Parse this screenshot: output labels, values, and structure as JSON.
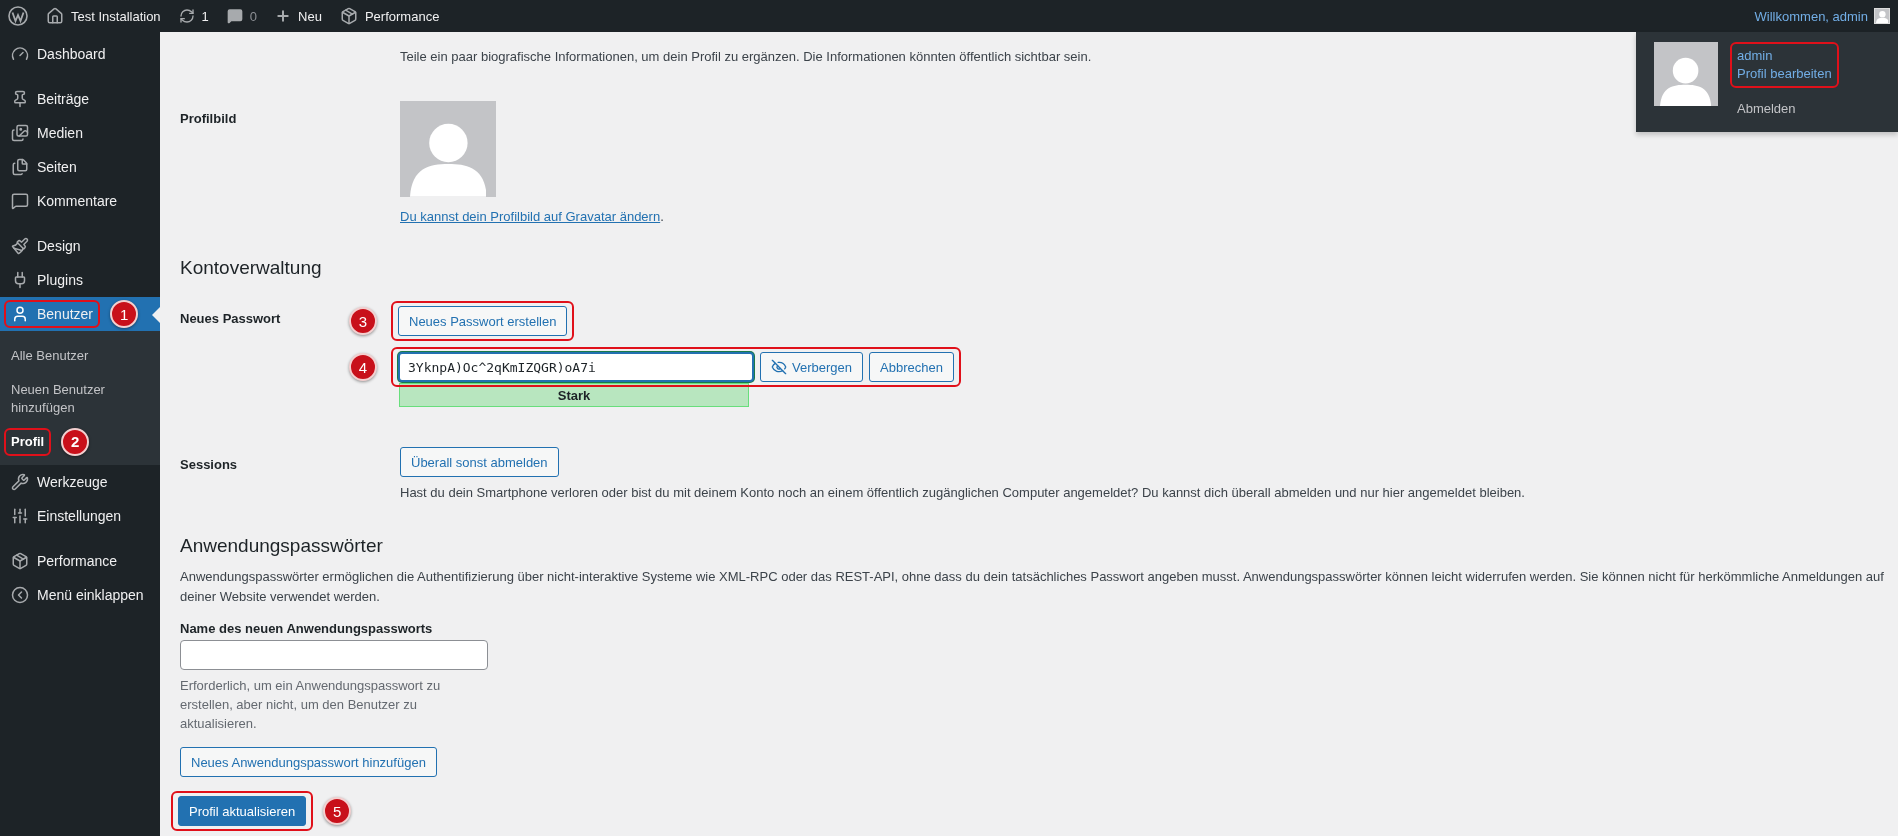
{
  "admin_bar": {
    "items": [
      {
        "kind": "logo"
      },
      {
        "kind": "site",
        "label": "Test Installation"
      },
      {
        "kind": "updates",
        "label": "1"
      },
      {
        "kind": "comments",
        "label": "0"
      },
      {
        "kind": "new",
        "label": "Neu"
      },
      {
        "kind": "performance",
        "label": "Performance"
      }
    ],
    "greeting": "Willkommen, admin"
  },
  "user_menu": {
    "name": "admin",
    "edit_link": "Profil bearbeiten",
    "logout": "Abmelden",
    "highlighted": true
  },
  "sidebar": {
    "groups": [
      [
        {
          "label": "Dashboard",
          "selected": false,
          "highlighted": false
        }
      ],
      [
        {
          "label": "Beiträge",
          "selected": false,
          "highlighted": false
        },
        {
          "label": "Medien",
          "selected": false,
          "highlighted": false
        },
        {
          "label": "Seiten",
          "selected": false,
          "highlighted": false
        },
        {
          "label": "Kommentare",
          "selected": false,
          "highlighted": false
        }
      ],
      [
        {
          "label": "Design",
          "selected": false,
          "highlighted": false
        },
        {
          "label": "Plugins",
          "selected": false,
          "highlighted": false
        },
        {
          "label": "Benutzer",
          "selected": true,
          "highlighted": true,
          "marker": "1",
          "children": [
            {
              "label": "Alle Benutzer",
              "selected": false,
              "highlighted": false
            },
            {
              "label": "Neuen Benutzer hinzufügen",
              "selected": false,
              "highlighted": false
            },
            {
              "label": "Profil",
              "selected": true,
              "highlighted": true,
              "marker": "2"
            }
          ]
        },
        {
          "label": "Werkzeuge",
          "selected": false,
          "highlighted": false
        },
        {
          "label": "Einstellungen",
          "selected": false,
          "highlighted": false
        }
      ],
      [
        {
          "label": "Performance",
          "selected": false,
          "highlighted": false
        },
        {
          "label": "Menü einklappen",
          "selected": false,
          "highlighted": false
        }
      ]
    ]
  },
  "intro": "Teile ein paar biografische Informationen, um dein Profil zu ergänzen. Die Informationen könnten öffentlich sichtbar sein.",
  "profile_picture": {
    "label": "Profilbild",
    "link": "Du kannst dein Profilbild auf Gravatar ändern",
    "suffix": "."
  },
  "account": {
    "heading": "Kontoverwaltung",
    "password_label": "Neues Passwort",
    "generate_button": {
      "label": "Neues Passwort erstellen",
      "highlighted": true,
      "marker": "3"
    },
    "password_field": {
      "value": "3YknpA)Oc^2qKmIZQGR)oA7i",
      "hide_button": "Verbergen",
      "cancel_button": "Abbrechen",
      "highlighted": true,
      "marker": "4"
    },
    "strength": {
      "label": "Stark",
      "kind": "strong"
    }
  },
  "sessions": {
    "label": "Sessions",
    "button": "Überall sonst abmelden",
    "description": "Hast du dein Smartphone verloren oder bist du mit deinem Konto noch an einem öffentlich zugänglichen Computer angemeldet? Du kannst dich überall abmelden und nur hier angemeldet bleiben."
  },
  "app_passwords": {
    "heading": "Anwendungspasswörter",
    "description": "Anwendungspasswörter ermöglichen die Authentifizierung über nicht-interaktive Systeme wie XML-RPC oder das REST-API, ohne dass du dein tatsächliches Passwort angeben musst. Anwendungspasswörter können leicht widerrufen werden. Sie können nicht für herkömmliche Anmeldungen auf deiner Website verwendet werden.",
    "name_label": "Name des neuen Anwendungspassworts",
    "help": "Erforderlich, um ein Anwendungspasswort zu erstellen, aber nicht, um den Benutzer zu aktualisieren.",
    "add_button": "Neues Anwendungspasswort hinzufügen"
  },
  "submit": {
    "label": "Profil aktualisieren",
    "highlighted": true,
    "marker": "5"
  }
}
